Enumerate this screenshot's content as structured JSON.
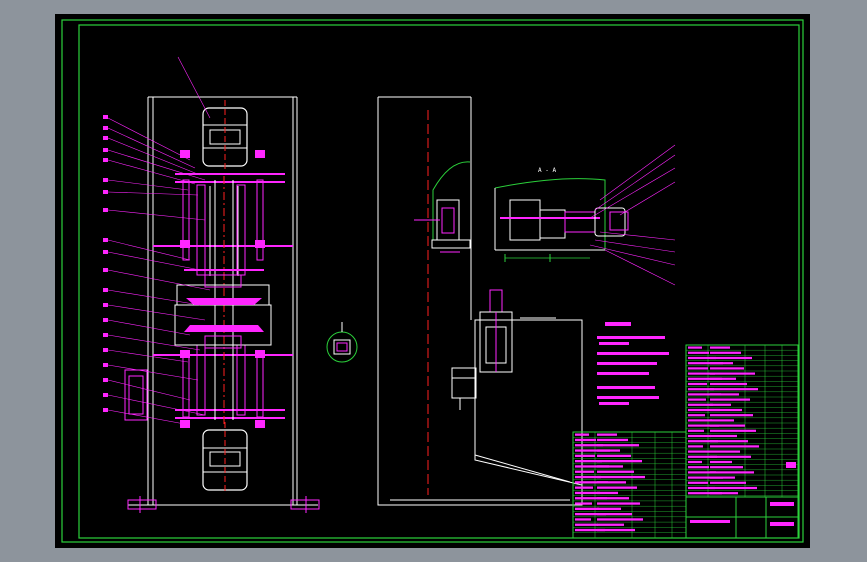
{
  "drawing": {
    "colors": {
      "background": "#000000",
      "frame": "#2bd13b",
      "outline": "#ffffff",
      "part": "#ff26ff",
      "centerline": "#ff2020",
      "leader": "#ff26ff",
      "table_grid": "#2bd13b"
    },
    "section_label": "A - A",
    "part_numbers": [
      "1",
      "2",
      "3",
      "4",
      "5",
      "6",
      "7",
      "8",
      "9",
      "10",
      "11",
      "12"
    ]
  }
}
